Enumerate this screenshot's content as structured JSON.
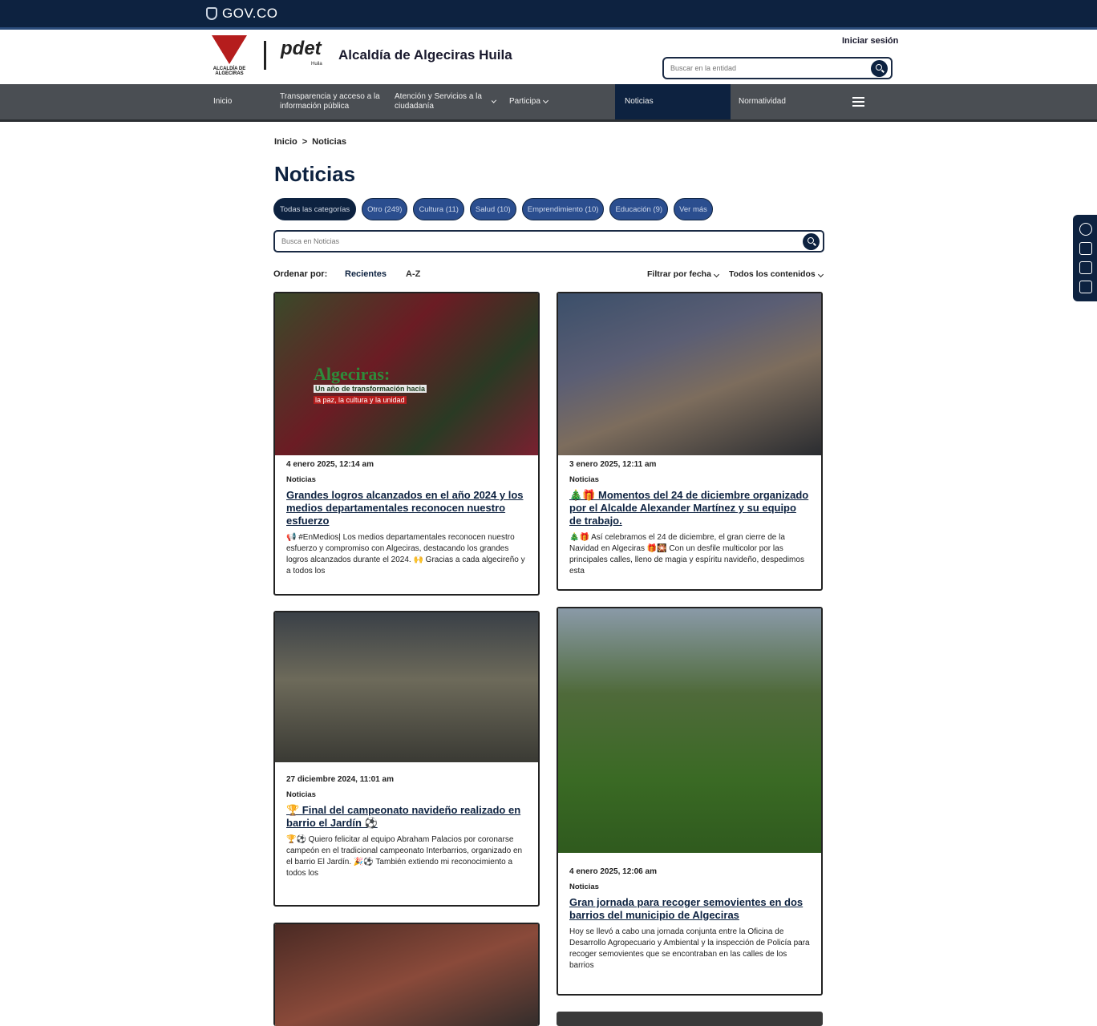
{
  "gov": {
    "logo_text": "GOV.CO"
  },
  "header": {
    "crest_caption": "ALCALDÍA DE ALGECIRAS",
    "pdet_logo": "pdet",
    "pdet_sub": "Huila",
    "entity_name": "Alcaldía de Algeciras Huila",
    "login_label": "Iniciar sesión",
    "search_placeholder": "Buscar en la entidad"
  },
  "nav": {
    "items": [
      {
        "label": "Inicio"
      },
      {
        "label": "Transparencia y acceso a la información pública"
      },
      {
        "label": "Atención y Servicios a la ciudadanía"
      },
      {
        "label": "Participa"
      },
      {
        "label": "Noticias"
      },
      {
        "label": "Normatividad"
      }
    ]
  },
  "breadcrumb": {
    "home": "Inicio",
    "separator": ">",
    "current": "Noticias"
  },
  "page_title": "Noticias",
  "categories": [
    {
      "label": "Todas las categorías"
    },
    {
      "label": "Otro (249)"
    },
    {
      "label": "Cultura (11)"
    },
    {
      "label": "Salud (10)"
    },
    {
      "label": "Emprendimiento (10)"
    },
    {
      "label": "Educación (9)"
    },
    {
      "label": "Ver más"
    }
  ],
  "news_search_placeholder": "Busca en Noticias",
  "sort": {
    "label": "Ordenar por:",
    "recent": "Recientes",
    "az": "A-Z",
    "filter_date": "Filtrar por fecha",
    "all_contents": "Todos los contenidos"
  },
  "cards": [
    {
      "date": "4 enero 2025, 12:14 am",
      "category": "Noticias",
      "title": "Grandes logros alcanzados en el año 2024 y los medios departamentales reconocen nuestro esfuerzo",
      "excerpt": "📢 #EnMedios| Los medios departamentales reconocen nuestro esfuerzo y compromiso con Algeciras, destacando los grandes logros alcanzados durante el 2024. 🙌 Gracias a cada algecireño y a todos los",
      "image_text": {
        "big": "Algeciras:",
        "sub": "Un año de transformación hacia",
        "sub2": "la paz, la cultura y la unidad"
      }
    },
    {
      "date": "3 enero 2025, 12:11 am",
      "category": "Noticias",
      "title": "🎄🎁 Momentos del 24 de diciembre organizado por el Alcalde Alexander Martínez y su equipo de trabajo.",
      "excerpt": "🎄🎁 Así celebramos el 24 de diciembre, el gran cierre de la Navidad en Algeciras 🎁🎇 Con un desfile multicolor por las principales calles, lleno de magia y espíritu navideño, despedimos esta"
    },
    {
      "date": "27 diciembre 2024, 11:01 am",
      "category": "Noticias",
      "title": "🏆 Final del campeonato navideño realizado en barrio el Jardín ⚽",
      "excerpt": "🏆⚽ Quiero felicitar al equipo Abraham Palacios por coronarse campeón en el tradicional campeonato Interbarrios, organizado en el barrio El Jardín. 🎉⚽ También extiendo mi reconocimiento a todos los"
    },
    {
      "date": "4 enero 2025, 12:06 am",
      "category": "Noticias",
      "title": "Gran jornada para recoger semovientes en dos barrios del municipio de Algeciras",
      "excerpt": "Hoy se llevó a cabo una jornada conjunta entre la Oficina de Desarrollo Agropecuario y Ambiental y la inspección de Policía para recoger semovientes que se encontraban en las calles de los barrios"
    }
  ],
  "icons": {
    "gov": "shield-icon",
    "search": "search-icon",
    "menu": "hamburger-menu-icon",
    "a11y": [
      "contrast-icon",
      "font-size-icon",
      "reduce-text-icon",
      "accessibility-icon"
    ]
  },
  "colors": {
    "primary": "#0d2240",
    "nav": "#4a4e53",
    "chip": "#2b4e8f",
    "accent": "#b51d1d"
  }
}
